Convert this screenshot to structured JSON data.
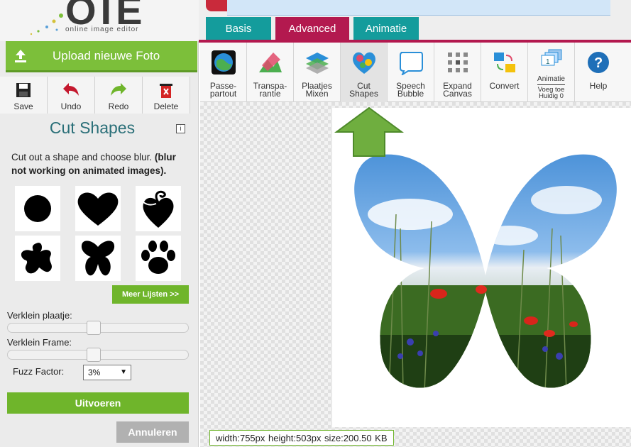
{
  "logo": {
    "letters": "OIE",
    "subtitle": "online image editor"
  },
  "upload": {
    "label": "Upload nieuwe Foto",
    "icon": "upload-icon"
  },
  "tools": [
    {
      "label": "Save",
      "icon": "save-icon"
    },
    {
      "label": "Undo",
      "icon": "undo-icon"
    },
    {
      "label": "Redo",
      "icon": "redo-icon"
    },
    {
      "label": "Delete",
      "icon": "delete-icon"
    }
  ],
  "panel": {
    "title": "Cut Shapes",
    "info_icon": "i",
    "description": "Cut out a shape and choose blur.",
    "description_bold": "(blur not working on animated images).",
    "shapes": [
      "circle",
      "heart",
      "fancy-heart",
      "splat",
      "butterfly",
      "paw"
    ],
    "more_button": "Meer Lijsten >>",
    "shrink_image_label": "Verklein plaatje:",
    "shrink_frame_label": "Verklein Frame:",
    "shrink_image_value": 0.47,
    "shrink_frame_value": 0.47,
    "fuzz_label": "Fuzz Factor:",
    "fuzz_value": "3%",
    "run_button": "Uitvoeren",
    "cancel_button": "Annuleren"
  },
  "tabs": [
    {
      "label": "Basis",
      "color": "#149c9c"
    },
    {
      "label": "Advanced",
      "color": "#b3194f"
    },
    {
      "label": "Animatie",
      "color": "#149c9c"
    }
  ],
  "features": [
    {
      "line1": "Passe-",
      "line2": "partout",
      "icon": "passepartout-icon"
    },
    {
      "line1": "Transpa-",
      "line2": "rantie",
      "icon": "transparency-icon"
    },
    {
      "line1": "Plaatjes",
      "line2": "Mixen",
      "icon": "mix-images-icon"
    },
    {
      "line1": "Cut",
      "line2": "Shapes",
      "icon": "cut-shapes-icon"
    },
    {
      "line1": "Speech",
      "line2": "Bubble",
      "icon": "speech-bubble-icon"
    },
    {
      "line1": "Expand",
      "line2": "Canvas",
      "icon": "expand-canvas-icon"
    },
    {
      "line1": "",
      "line2": "Convert",
      "icon": "convert-icon"
    },
    {
      "line1": "Animatie",
      "line2": "Voeg toe Huidig 0",
      "icon": "animation-icon"
    },
    {
      "line1": "",
      "line2": "Help",
      "icon": "help-icon"
    }
  ],
  "status": "width:755px  height:503px  size:200.50 KB",
  "colors": {
    "accent_green": "#6fb52b",
    "title_teal": "#2a6f78",
    "tab_active": "#b3194f",
    "tab_teal": "#149c9c"
  }
}
